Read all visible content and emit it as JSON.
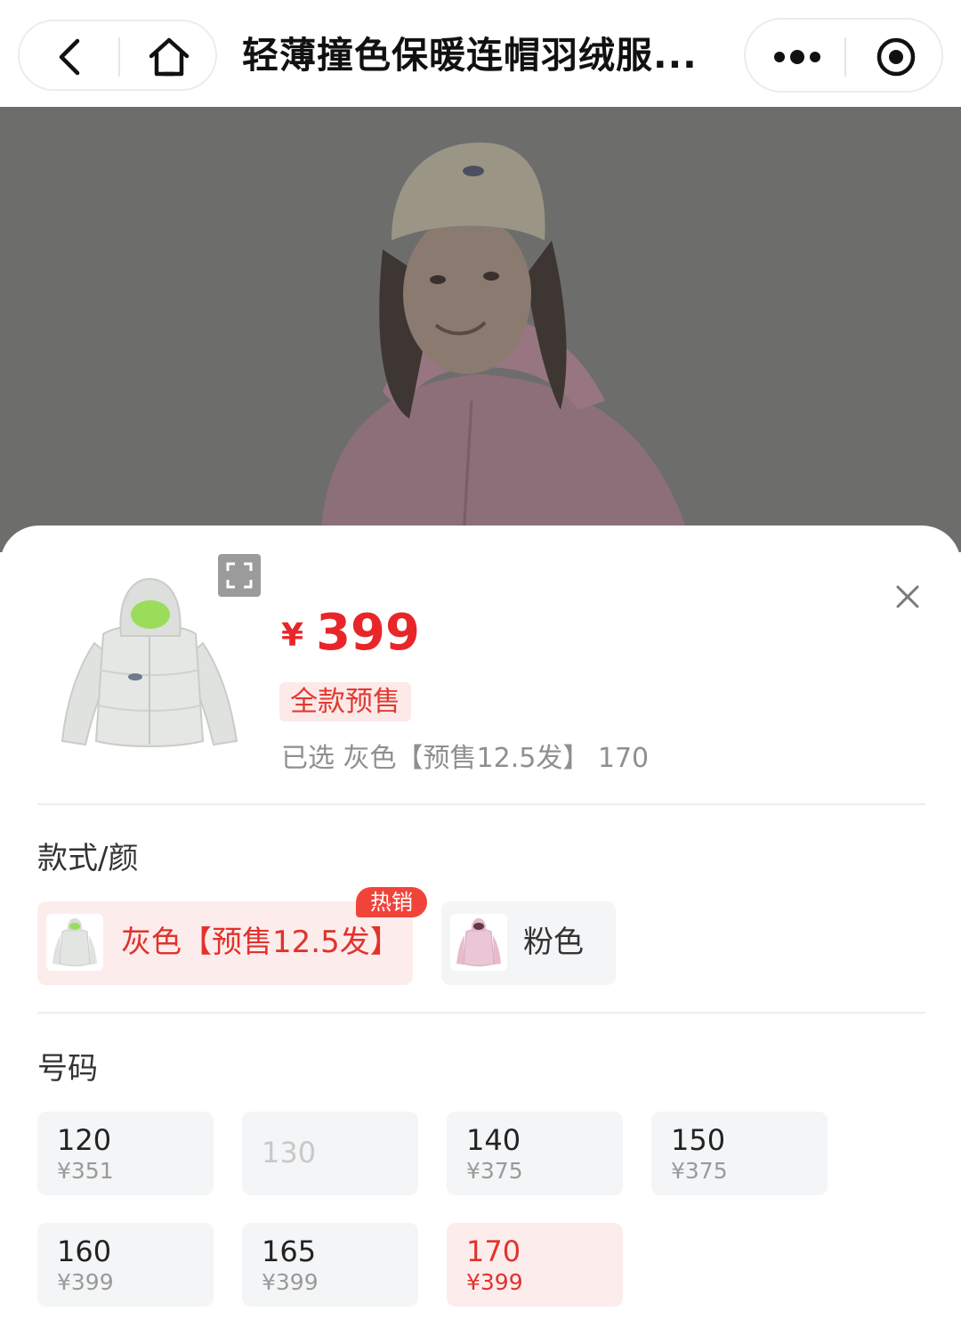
{
  "nav": {
    "title": "轻薄撞色保暖连帽羽绒服...",
    "back_icon": "chevron-left-icon",
    "home_icon": "home-icon",
    "more_icon": "more-dots-icon",
    "close_icon": "target-circle-icon"
  },
  "hero": {
    "image": "model-in-pink-hooded-down-jacket-photo"
  },
  "product": {
    "currency": "¥",
    "price": "399",
    "tag": "全款预售",
    "selected_text": "已选 灰色【预售12.5发】 170"
  },
  "colors": {
    "title": "款式/颜",
    "hot_badge": "热销",
    "options": [
      {
        "label": "灰色【预售12.5发】",
        "selected": true,
        "swatch": "#e3e6e2"
      },
      {
        "label": "粉色",
        "selected": false,
        "swatch": "#e9c2d2"
      }
    ]
  },
  "sizes": {
    "title": "号码",
    "options": [
      {
        "size": "120",
        "price": "¥351",
        "state": "normal"
      },
      {
        "size": "130",
        "price": "",
        "state": "disabled"
      },
      {
        "size": "140",
        "price": "¥375",
        "state": "normal"
      },
      {
        "size": "150",
        "price": "¥375",
        "state": "normal"
      },
      {
        "size": "160",
        "price": "¥399",
        "state": "normal"
      },
      {
        "size": "165",
        "price": "¥399",
        "state": "normal"
      },
      {
        "size": "170",
        "price": "¥399",
        "state": "selected"
      }
    ]
  },
  "colors_theme": {
    "accent": "#e8262a",
    "selected_bg": "#fdecec",
    "option_bg": "#f4f5f6"
  }
}
